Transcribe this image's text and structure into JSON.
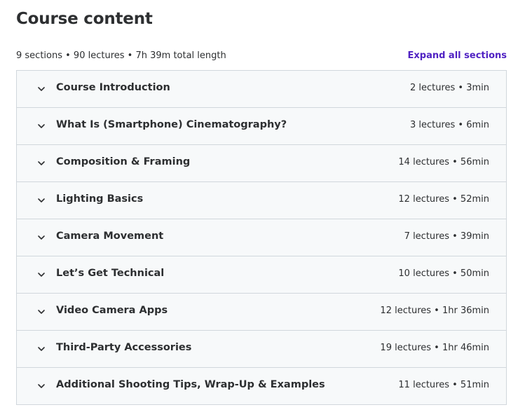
{
  "header": {
    "title": "Course content",
    "summary": "9 sections • 90 lectures • 7h 39m total length",
    "expand_label": "Expand all sections"
  },
  "colors": {
    "accent": "#5022c3",
    "text": "#2d2f31",
    "row_bg": "#f7f9fa",
    "border": "#d1d7dc"
  },
  "icons": {
    "section_toggle": "chevron-down-icon"
  },
  "sections": [
    {
      "title": "Course Introduction",
      "meta": "2 lectures • 3min"
    },
    {
      "title": "What Is (Smartphone) Cinematography?",
      "meta": "3 lectures • 6min"
    },
    {
      "title": "Composition & Framing",
      "meta": "14 lectures • 56min"
    },
    {
      "title": "Lighting Basics",
      "meta": "12 lectures • 52min"
    },
    {
      "title": "Camera Movement",
      "meta": "7 lectures • 39min"
    },
    {
      "title": "Let’s Get Technical",
      "meta": "10 lectures • 50min"
    },
    {
      "title": "Video Camera Apps",
      "meta": "12 lectures • 1hr 36min"
    },
    {
      "title": "Third-Party Accessories",
      "meta": "19 lectures • 1hr 46min"
    },
    {
      "title": "Additional Shooting Tips, Wrap-Up & Examples",
      "meta": "11 lectures • 51min"
    }
  ]
}
